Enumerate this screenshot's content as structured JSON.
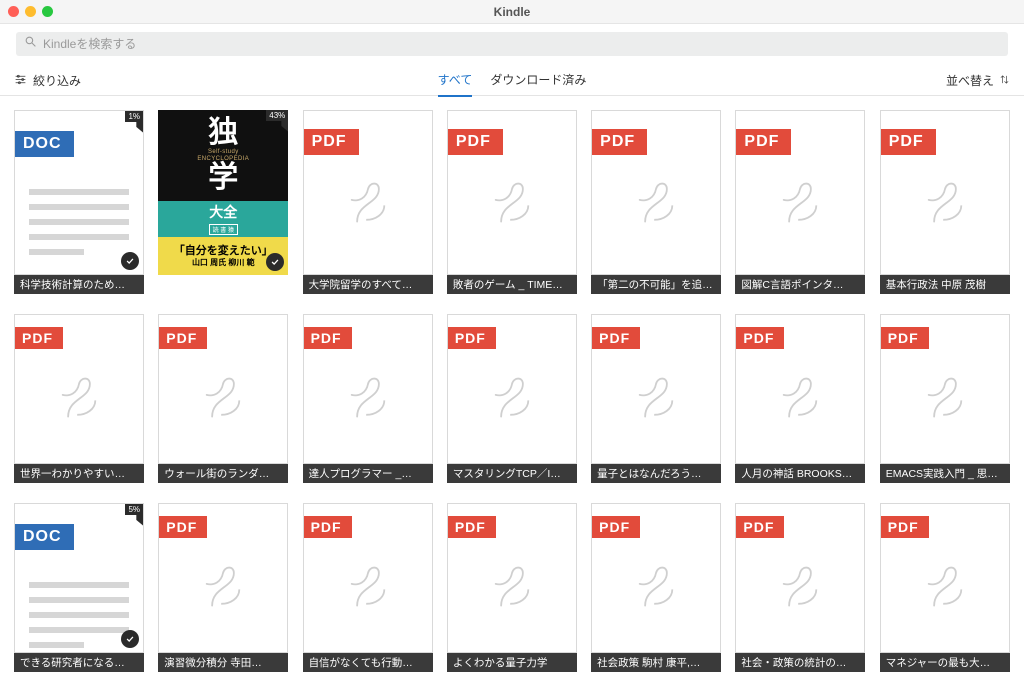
{
  "window": {
    "title": "Kindle"
  },
  "search": {
    "placeholder": "Kindleを検索する"
  },
  "toolbar": {
    "filter_label": "絞り込み",
    "sort_label": "並べ替え",
    "tabs": {
      "all": "すべて",
      "downloaded": "ダウンロード済み"
    }
  },
  "labels": {
    "pdf": "PDF",
    "doc": "DOC"
  },
  "cover2": {
    "kanji_top": "独",
    "eng1": "Self-study",
    "eng2": "ENCYCLOPEDIA",
    "kanji_bot": "学",
    "mid_big": "大全",
    "mid_sub": "読 書 猿",
    "obi_quote": "「自分を変えたい」",
    "obi_names": "山口 周氏  柳川 範"
  },
  "books": [
    {
      "kind": "doc",
      "title": "科学技術計算のため…",
      "progress": "1%",
      "downloaded": true
    },
    {
      "kind": "img",
      "title": "",
      "progress": "43%",
      "downloaded": true
    },
    {
      "kind": "pdf",
      "title": "大学院留学のすべて…"
    },
    {
      "kind": "pdf",
      "title": "敗者のゲーム _ TIME…"
    },
    {
      "kind": "pdf",
      "title": "「第二の不可能」を追…"
    },
    {
      "kind": "pdf",
      "title": "図解C言語ポインタ…"
    },
    {
      "kind": "pdf",
      "title": "基本行政法 中原 茂樹"
    },
    {
      "kind": "pdf",
      "title": "世界一わかりやすい…"
    },
    {
      "kind": "pdf",
      "title": "ウォール街のランダ…"
    },
    {
      "kind": "pdf",
      "title": "達人プログラマー _…"
    },
    {
      "kind": "pdf",
      "title": "マスタリングTCP／I…"
    },
    {
      "kind": "pdf",
      "title": "量子とはなんだろう…"
    },
    {
      "kind": "pdf",
      "title": "人月の神話 BROOKS…"
    },
    {
      "kind": "pdf",
      "title": "EMACS実践入門 _  思…"
    },
    {
      "kind": "doc",
      "title": "できる研究者になる…",
      "progress": "5%",
      "downloaded": true
    },
    {
      "kind": "pdf",
      "title": "演習微分積分 寺田…"
    },
    {
      "kind": "pdf",
      "title": "自信がなくても行動…"
    },
    {
      "kind": "pdf",
      "title": "よくわかる量子力学"
    },
    {
      "kind": "pdf",
      "title": "社会政策 駒村 康平,…"
    },
    {
      "kind": "pdf",
      "title": "社会・政策の統計の…"
    },
    {
      "kind": "pdf",
      "title": "マネジャーの最も大…"
    }
  ]
}
